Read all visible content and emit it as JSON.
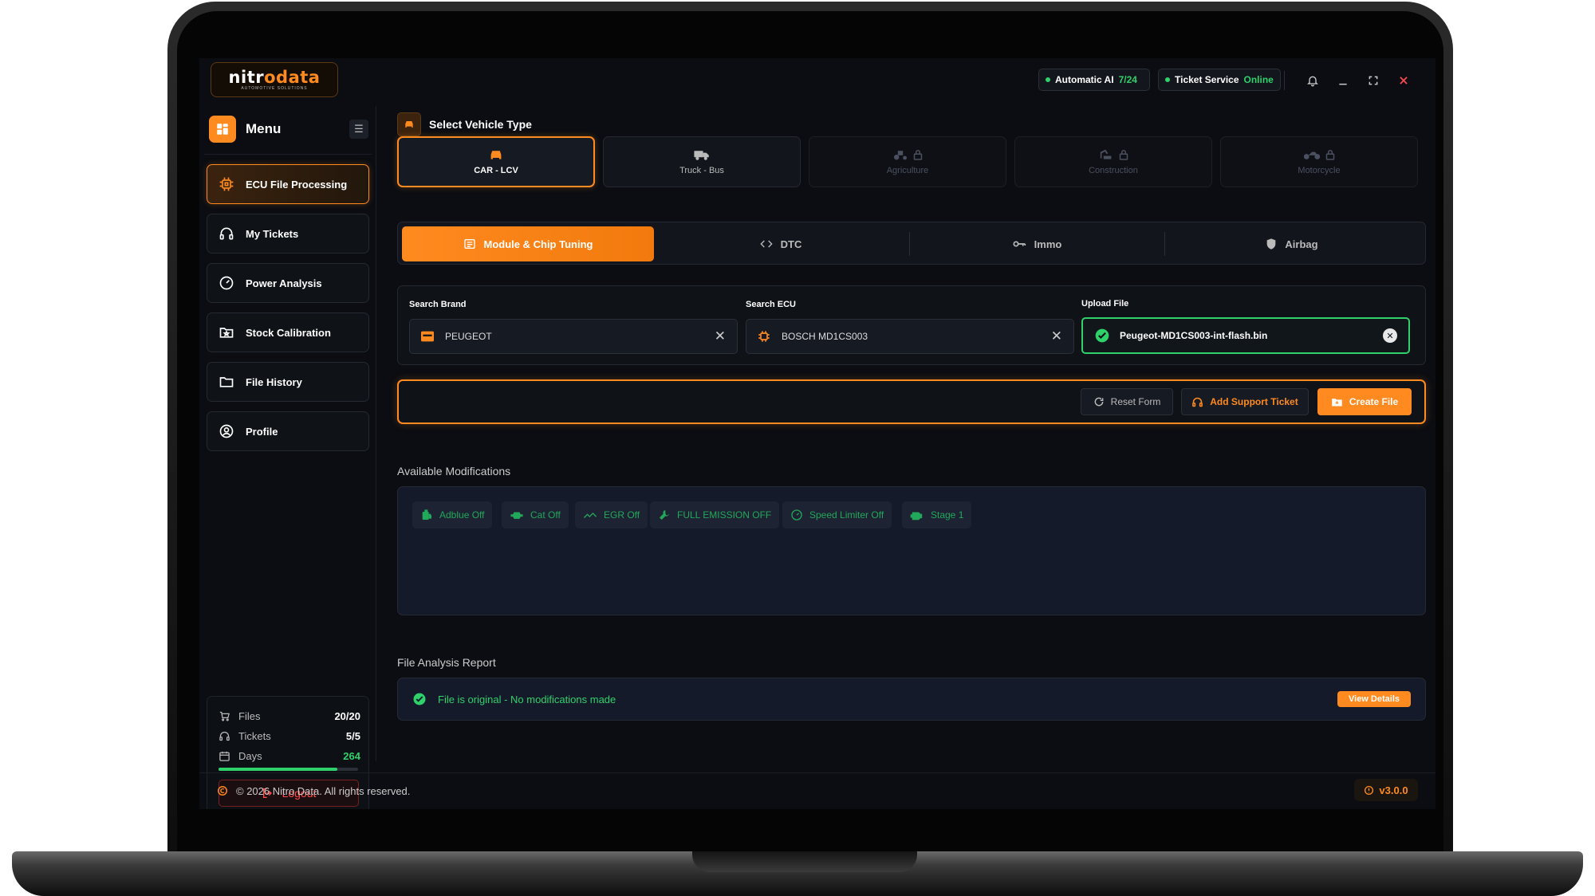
{
  "app": {
    "logo_main_a": "nitr",
    "logo_main_o": "o",
    "logo_main_b": "data",
    "logo_tagline": "AUTOMOTIVE SOLUTIONS"
  },
  "header": {
    "status_ai": {
      "label": "Automatic AI",
      "value": "7/24"
    },
    "status_ticket": {
      "label": "Ticket Service",
      "value": "Online"
    },
    "icons": [
      "bell-icon",
      "minimize-icon",
      "maximize-icon",
      "close-icon"
    ]
  },
  "sidebar": {
    "menu_title": "Menu",
    "items": [
      {
        "label": "ECU File Processing",
        "icon": "chip-icon",
        "active": true
      },
      {
        "label": "My Tickets",
        "icon": "headset-icon",
        "active": false
      },
      {
        "label": "Power Analysis",
        "icon": "gauge-icon",
        "active": false
      },
      {
        "label": "Stock Calibration",
        "icon": "folder-star-icon",
        "active": false
      },
      {
        "label": "File History",
        "icon": "folder-icon",
        "active": false
      },
      {
        "label": "Profile",
        "icon": "user-circle-icon",
        "active": false
      }
    ],
    "stats": {
      "files": {
        "label": "Files",
        "value": "20/20"
      },
      "tickets": {
        "label": "Tickets",
        "value": "5/5"
      },
      "days": {
        "label": "Days",
        "value": "264"
      },
      "days_progress": 0.85
    },
    "logout_label": "Logout"
  },
  "main": {
    "vehicle_section_title": "Select Vehicle Type",
    "vehicle_types": [
      {
        "label": "CAR - LCV",
        "icon": "car-icon",
        "state": "active"
      },
      {
        "label": "Truck - Bus",
        "icon": "truck-icon",
        "state": "available"
      },
      {
        "label": "Agriculture",
        "icon": "tractor-icon",
        "state": "locked"
      },
      {
        "label": "Construction",
        "icon": "excavator-icon",
        "state": "locked"
      },
      {
        "label": "Motorcycle",
        "icon": "motorcycle-icon",
        "state": "locked"
      }
    ],
    "tabs": [
      {
        "label": "Module & Chip Tuning",
        "icon": "module-icon",
        "active": true
      },
      {
        "label": "DTC",
        "icon": "code-icon",
        "active": false
      },
      {
        "label": "Immo",
        "icon": "key-icon",
        "active": false
      },
      {
        "label": "Airbag",
        "icon": "shield-icon",
        "active": false
      }
    ],
    "search": {
      "brand_label": "Search Brand",
      "brand_value": "PEUGEOT",
      "ecu_label": "Search ECU",
      "ecu_value": "BOSCH MD1CS003",
      "upload_label": "Upload File",
      "upload_value": "Peugeot-MD1CS003-int-flash.bin"
    },
    "actions": {
      "reset_label": "Reset Form",
      "support_label": "Add Support Ticket",
      "create_label": "Create File"
    },
    "modifications_title": "Available Modifications",
    "modifications": [
      {
        "label": "Adblue Off",
        "icon": "adblue-icon"
      },
      {
        "label": "Cat Off",
        "icon": "catalyst-icon"
      },
      {
        "label": "EGR Off",
        "icon": "egr-icon"
      },
      {
        "label": "FULL EMISSION OFF",
        "icon": "wrench-icon"
      },
      {
        "label": "Speed Limiter Off",
        "icon": "speed-icon"
      },
      {
        "label": "Stage 1",
        "icon": "engine-icon"
      }
    ],
    "report_title": "File Analysis Report",
    "report_status": "File is original - No modifications made",
    "view_details_label": "View Details"
  },
  "footer": {
    "copyright": "© 2026 Nitro Data. All rights reserved.",
    "version": "v3.0.0"
  },
  "colors": {
    "accent": "#ff8a1f",
    "success": "#2ed16a",
    "danger": "#ff4a4a",
    "background": "#0b0d12",
    "panel": "#151a2a"
  }
}
